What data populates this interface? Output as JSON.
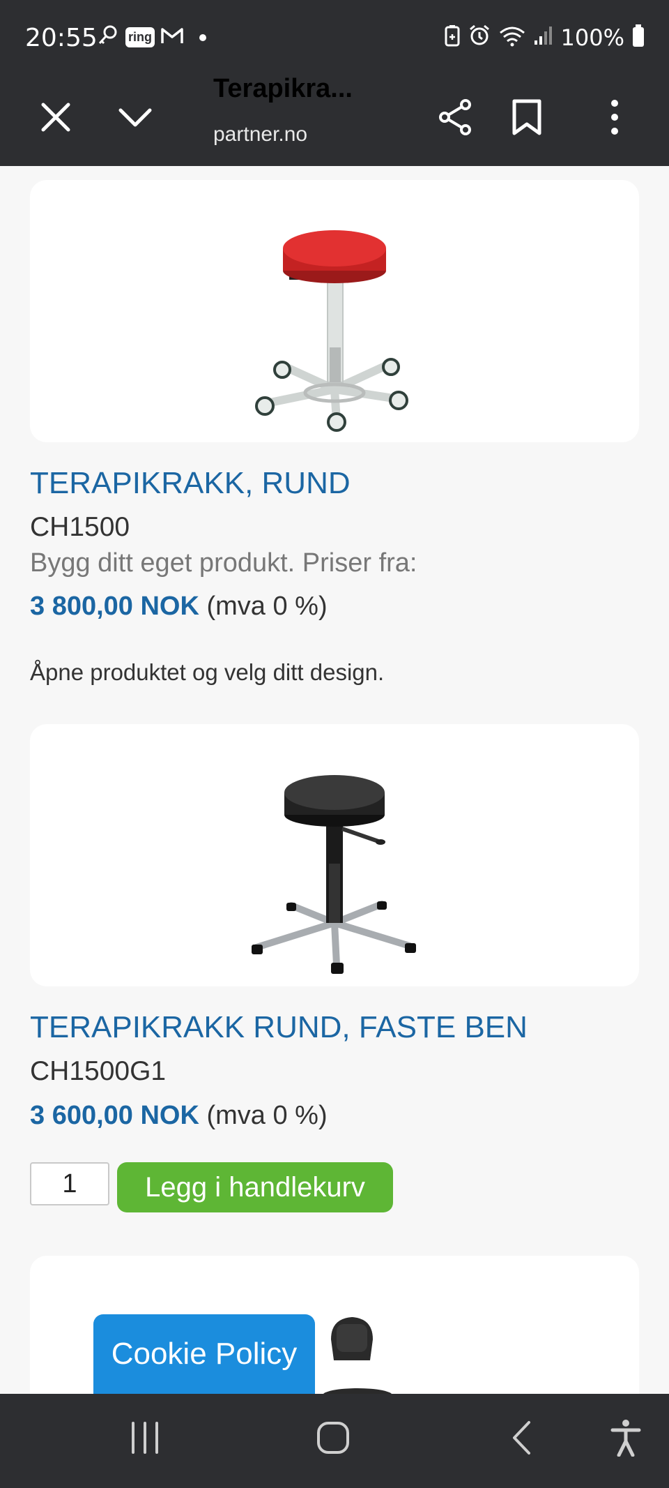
{
  "status_bar": {
    "time": "20:55",
    "battery": "100%",
    "ring_label": "ring"
  },
  "toolbar": {
    "title": "Terapikra...",
    "url": "partner.no"
  },
  "products": [
    {
      "name": "TERAPIKRAKK, RUND",
      "sku": "CH1500",
      "note": "Bygg ditt eget produkt. Priser fra:",
      "price": "3 800,00 NOK",
      "vat": "(mva 0 %)",
      "cta_text": "Åpne produktet og velg ditt design."
    },
    {
      "name": "TERAPIKRAKK RUND, FASTE BEN",
      "sku": "CH1500G1",
      "price": "3 600,00 NOK",
      "vat": "(mva 0 %)",
      "quantity": "1",
      "add_to_cart": "Legg i handlekurv"
    }
  ],
  "cookie_button": "Cookie Policy",
  "colors": {
    "accent_blue": "#1b66a3",
    "cart_green": "#5eb635",
    "cookie_blue": "#1b8ddd",
    "bar_dark": "#2d2e31"
  }
}
